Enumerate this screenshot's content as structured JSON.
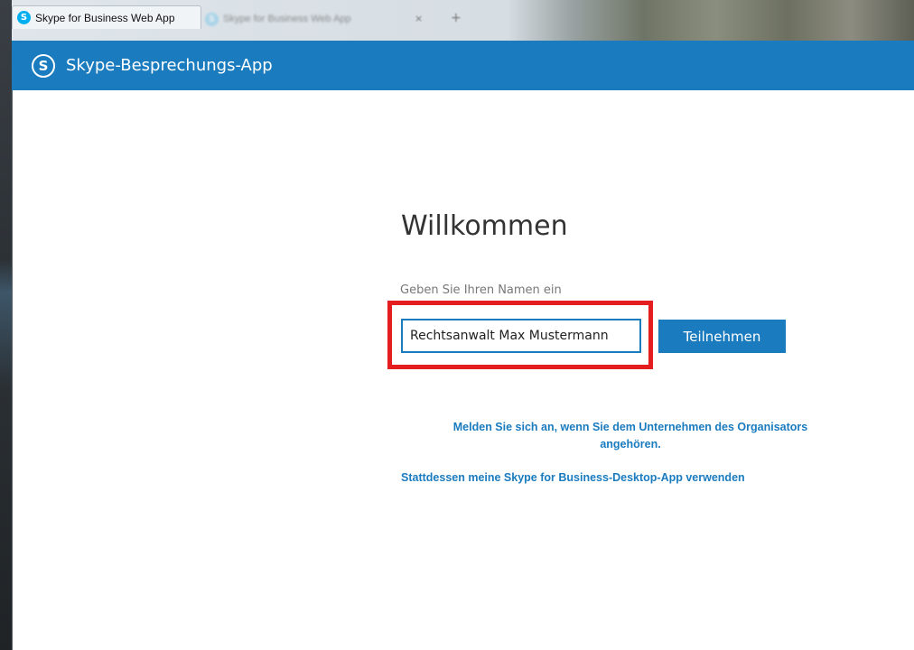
{
  "browser": {
    "active_tab_title": "Skype for Business Web App",
    "active_tab_icon": "skype-icon",
    "inactive_tab_title": "Skype for Business Web App",
    "tab_close_glyph": "×",
    "new_tab_glyph": "+"
  },
  "header": {
    "logo": "skype-logo-icon",
    "logo_letter": "S",
    "title": "Skype-Besprechungs-App",
    "background_color": "#1a7bbf"
  },
  "main": {
    "welcome_title": "Willkommen",
    "name_label": "Geben Sie Ihren Namen ein",
    "name_input_value": "Rechtsanwalt Max Mustermann",
    "join_button_label": "Teilnehmen",
    "signin_link": "Melden Sie sich an, wenn Sie dem Unternehmen des Organisators angehören.",
    "desktop_app_link": "Stattdessen meine Skype for Business-Desktop-App verwenden"
  },
  "colors": {
    "accent": "#1a7bbf",
    "highlight": "#e41e1e"
  }
}
